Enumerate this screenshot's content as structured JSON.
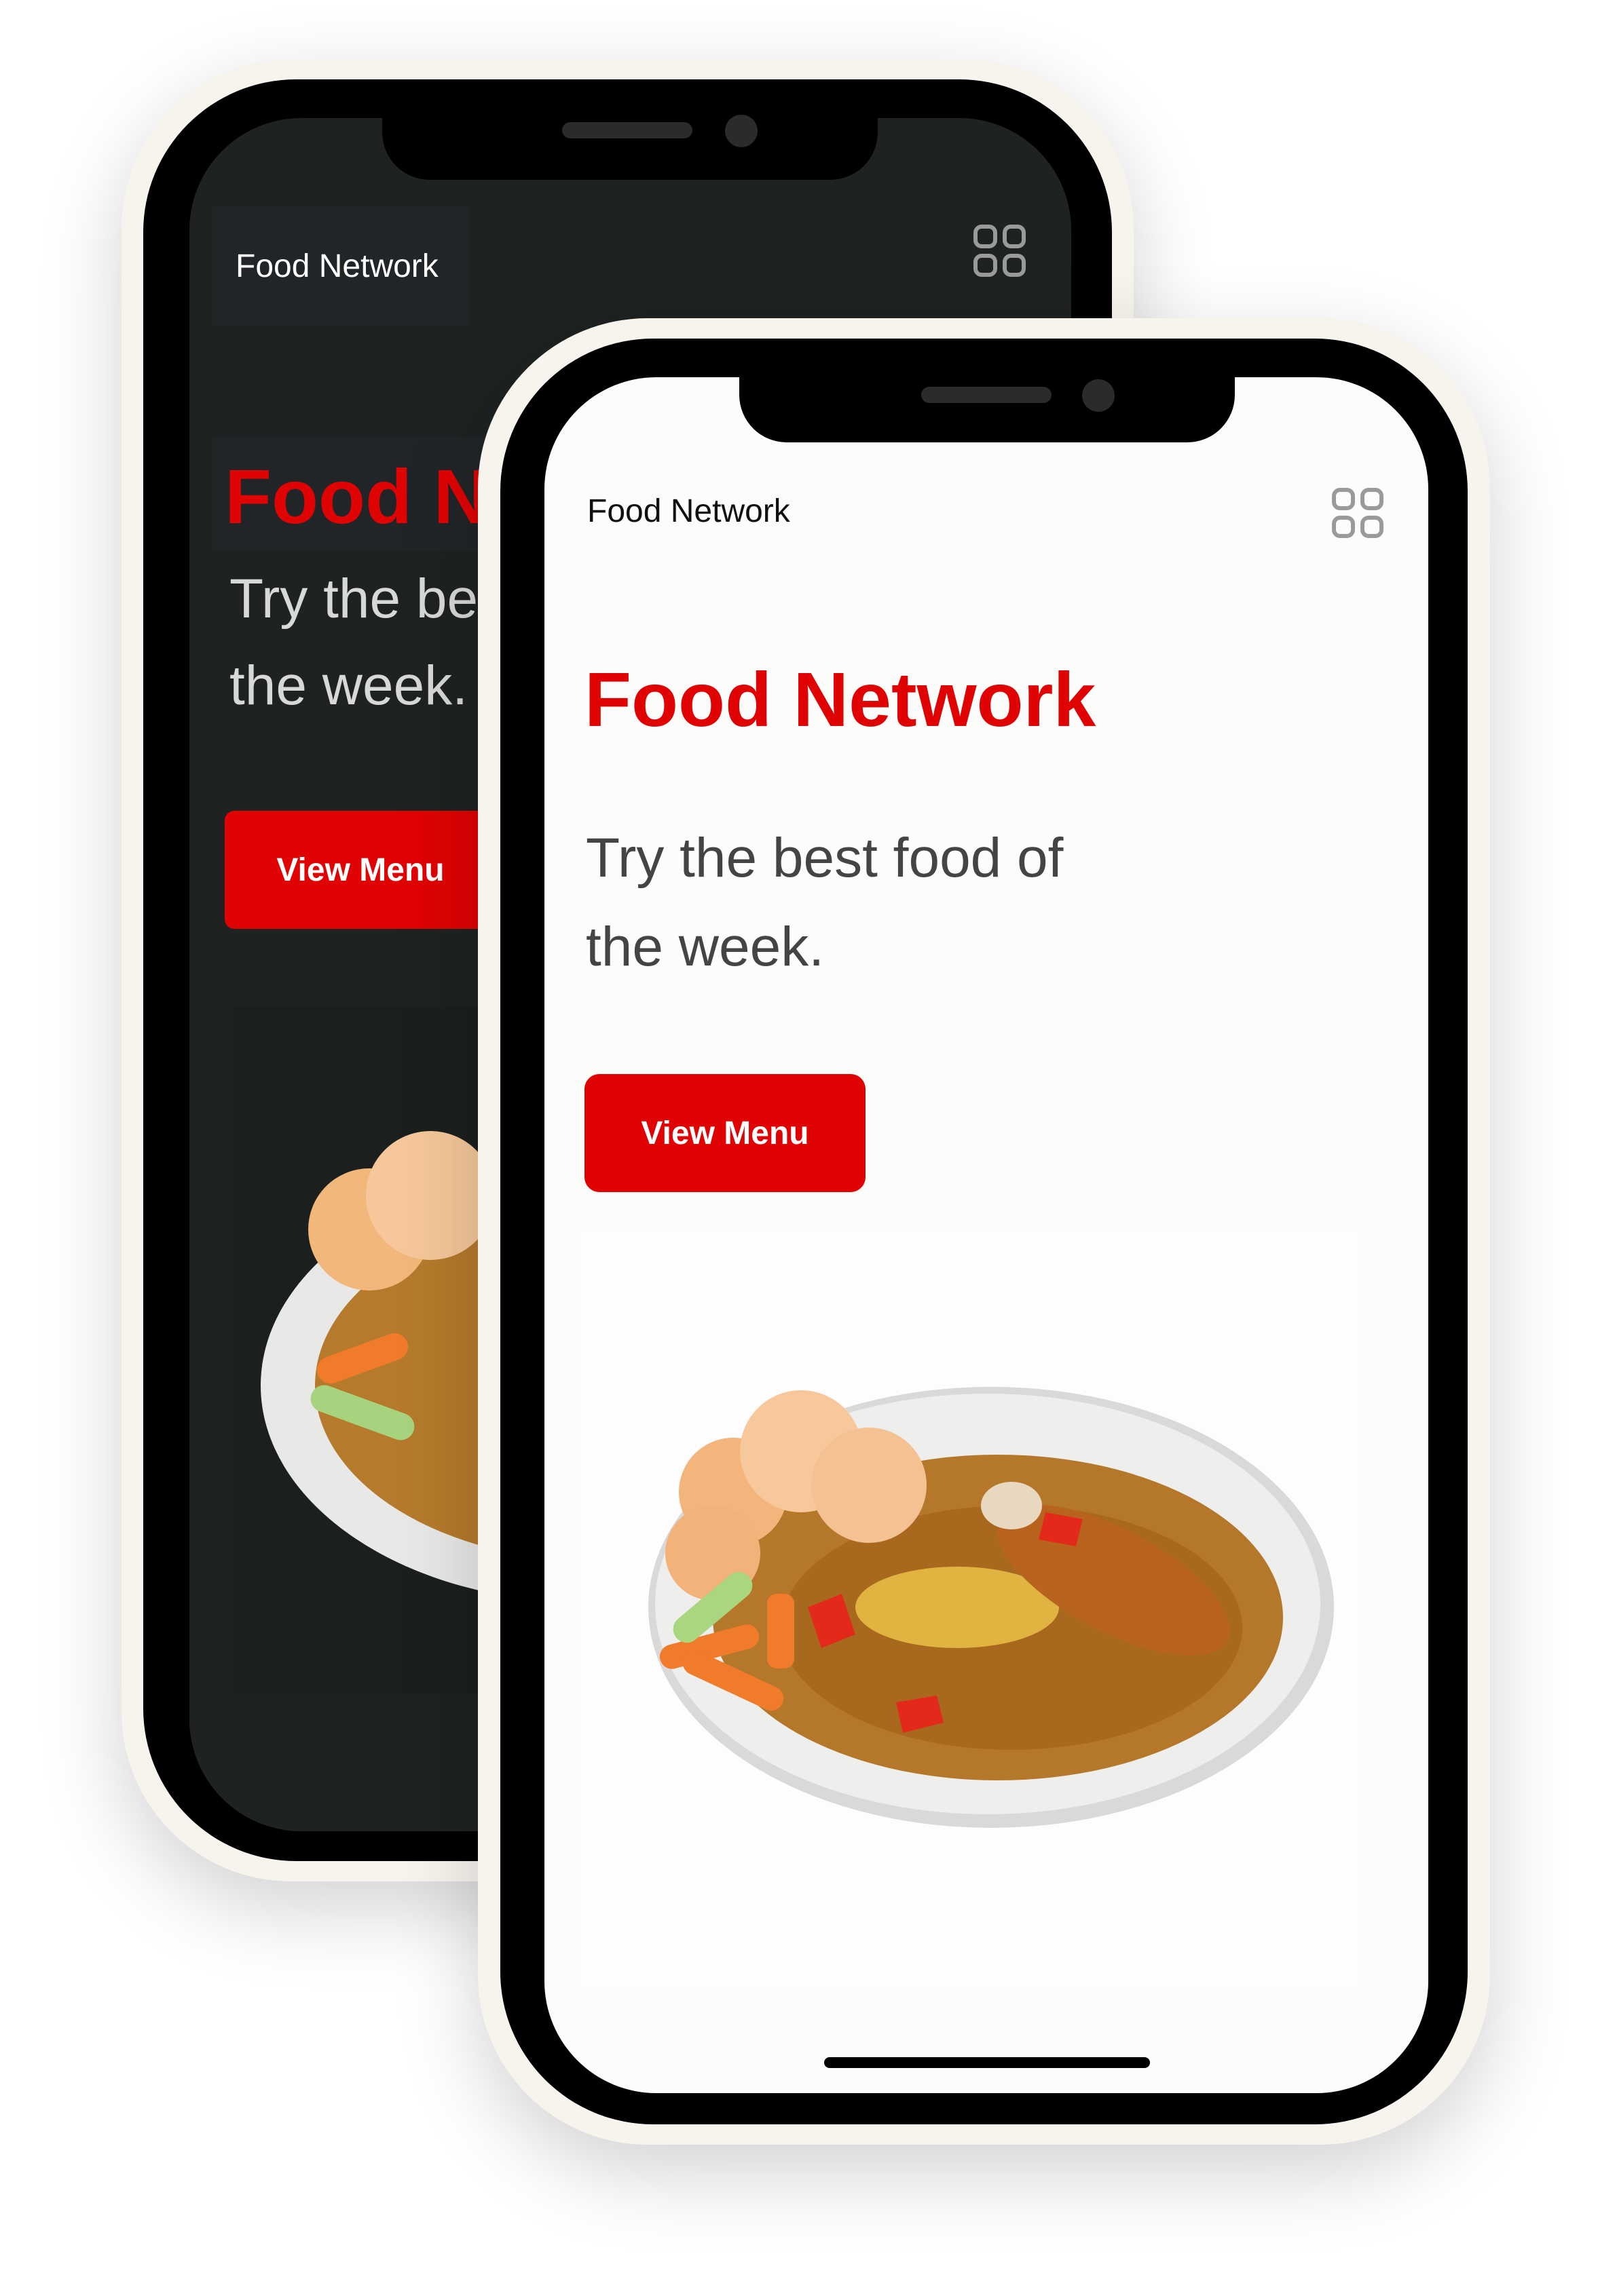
{
  "back_phone": {
    "theme": "dark",
    "nav": {
      "brand": "Food Network",
      "menu_icon": "grid-icon"
    },
    "hero": {
      "title": "Food Network",
      "subtitle_line1": "Try the best food of",
      "subtitle_line2": "the week.",
      "button_label": "View Menu"
    }
  },
  "front_phone": {
    "theme": "light",
    "nav": {
      "brand": "Food Network",
      "menu_icon": "grid-icon"
    },
    "hero": {
      "title": "Food Network",
      "subtitle_line1": "Try the best food of",
      "subtitle_line2": "the week.",
      "button_label": "View Menu"
    }
  },
  "colors": {
    "accent": "#e00303",
    "dark_bg": "#1e2220",
    "frame": "#f7f4ee"
  }
}
